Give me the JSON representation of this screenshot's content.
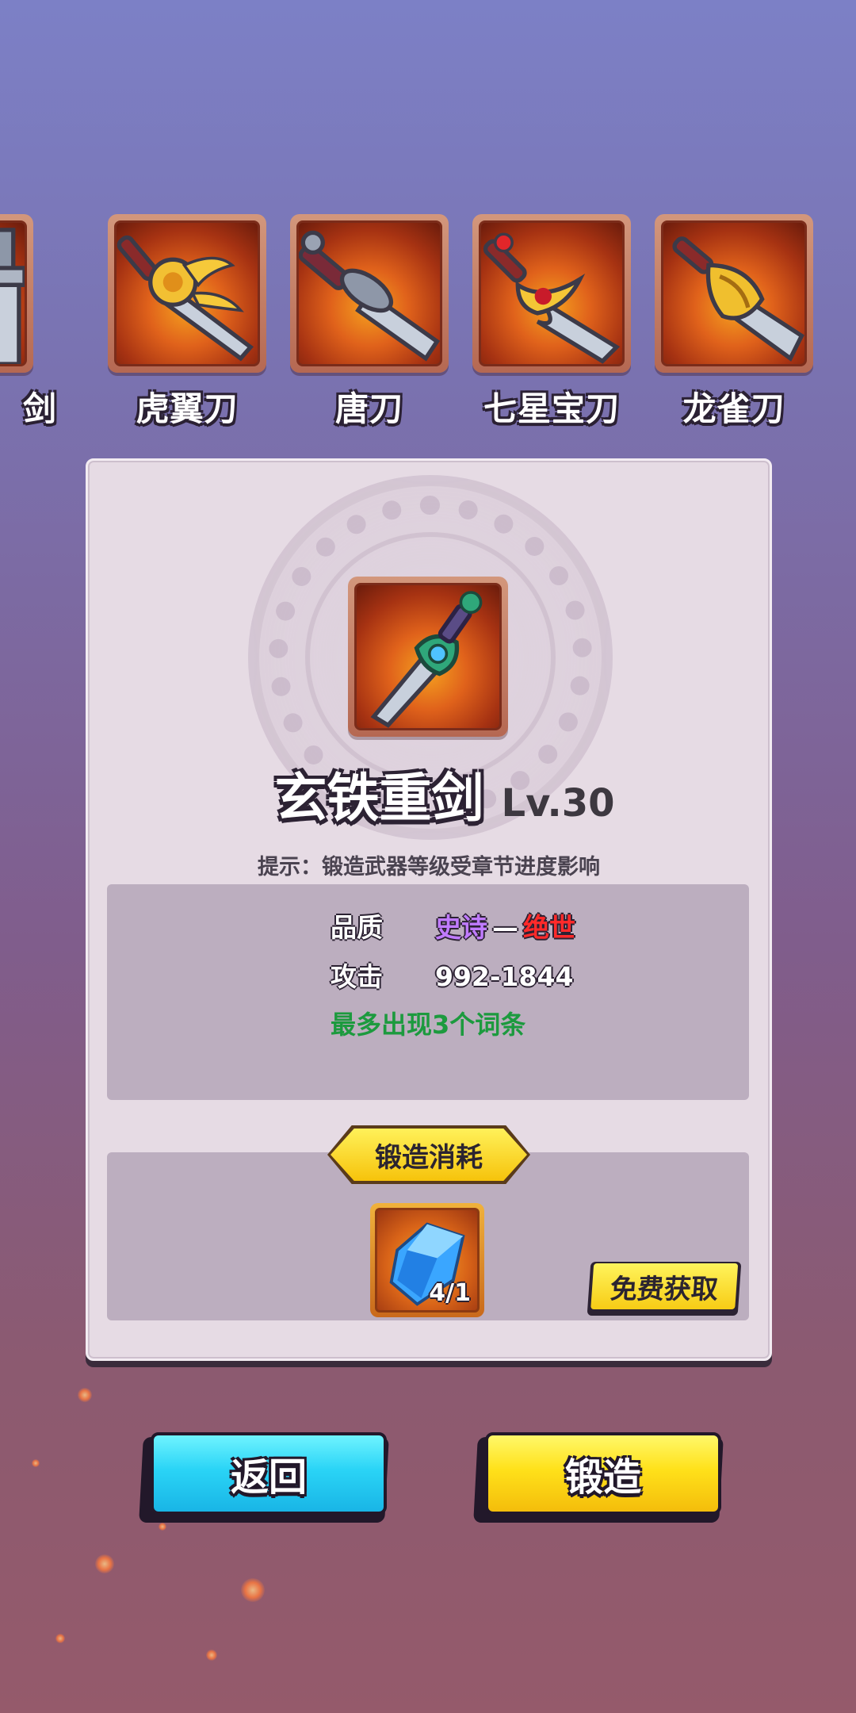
{
  "weapon_strip": {
    "items": [
      {
        "name": "剑",
        "icon": "sword-icon",
        "partial": true
      },
      {
        "name": "虎翼刀",
        "icon": "golden-winged-blade-icon"
      },
      {
        "name": "唐刀",
        "icon": "tang-dao-icon"
      },
      {
        "name": "七星宝刀",
        "icon": "seven-star-saber-icon"
      },
      {
        "name": "龙雀刀",
        "icon": "dragon-sparrow-blade-icon"
      }
    ]
  },
  "detail": {
    "weapon_name": "玄铁重剑",
    "level": "Lv.30",
    "icon": "jade-heavy-sword-icon",
    "hint": "提示：锻造武器等级受章节进度影响",
    "stats": {
      "quality_label": "品质",
      "quality_low": "史诗",
      "quality_sep": "—",
      "quality_high": "绝世",
      "attack_label": "攻击",
      "attack_value": "992-1844",
      "bonus": "最多出现3个词条"
    },
    "cost": {
      "title": "锻造消耗",
      "material_icon": "blue-crystal-icon",
      "material_count": "4/1",
      "free_button": "免费获取"
    }
  },
  "buttons": {
    "back": "返回",
    "forge": "锻造"
  },
  "colors": {
    "epic": "#c07bff",
    "legendary": "#ff2a2a",
    "bonus": "#1c9a3e",
    "button_back": "#2ad4f6",
    "button_forge": "#ffe11a"
  }
}
